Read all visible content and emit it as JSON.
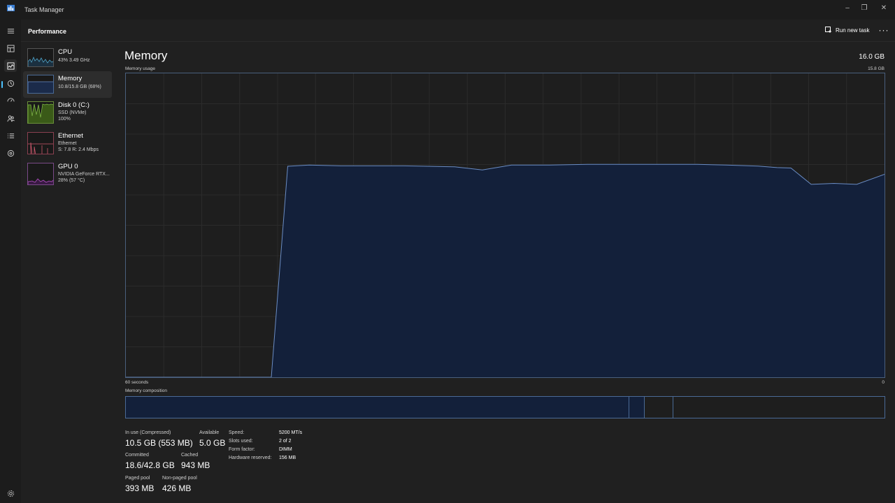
{
  "window": {
    "title": "Task Manager",
    "controls": {
      "minimize": "–",
      "restore": "❐",
      "close": "✕"
    }
  },
  "nav": {
    "items": [
      {
        "name": "hamburger-icon"
      },
      {
        "name": "processes-icon"
      },
      {
        "name": "performance-icon",
        "active": true
      },
      {
        "name": "app-history-icon"
      },
      {
        "name": "startup-apps-icon"
      },
      {
        "name": "users-icon"
      },
      {
        "name": "details-icon"
      },
      {
        "name": "services-icon"
      }
    ],
    "settings": {
      "name": "gear-icon"
    }
  },
  "header": {
    "title": "Performance",
    "run_new_task": "Run new task",
    "more": "···"
  },
  "sidebar": {
    "items": [
      {
        "name": "CPU",
        "sub1": "43%  3.49 GHz",
        "sub2": "",
        "color": "#4fa3c7"
      },
      {
        "name": "Memory",
        "sub1": "10.8/15.8 GB (68%)",
        "sub2": "",
        "color": "#4a6fa5",
        "selected": true
      },
      {
        "name": "Disk 0 (C:)",
        "sub1": "SSD (NVMe)",
        "sub2": "100%",
        "color": "#7db446"
      },
      {
        "name": "Ethernet",
        "sub1": "Ethernet",
        "sub2": "S: 7.8  R: 2.4 Mbps",
        "color": "#d05a6e"
      },
      {
        "name": "GPU 0",
        "sub1": "NVIDIA GeForce RTX...",
        "sub2": "28%  (57 °C)",
        "color": "#b04fc0"
      }
    ]
  },
  "main": {
    "title": "Memory",
    "total": "16.0 GB",
    "usage_label": "Memory usage",
    "usage_max": "15.8 GB",
    "time_label": "60 seconds",
    "time_end": "0",
    "composition_label": "Memory composition",
    "stats": {
      "in_use_label": "In use (Compressed)",
      "in_use_value": "10.5 GB (553 MB)",
      "available_label": "Available",
      "available_value": "5.0 GB",
      "committed_label": "Committed",
      "committed_value": "18.6/42.8 GB",
      "cached_label": "Cached",
      "cached_value": "943 MB",
      "paged_label": "Paged pool",
      "paged_value": "393 MB",
      "nonpaged_label": "Non-paged pool",
      "nonpaged_value": "426 MB"
    },
    "specs": [
      {
        "label": "Speed:",
        "value": "5200 MT/s"
      },
      {
        "label": "Slots used:",
        "value": "2 of 2"
      },
      {
        "label": "Form factor:",
        "value": "DIMM"
      },
      {
        "label": "Hardware reserved:",
        "value": "156 MB"
      }
    ]
  },
  "colors": {
    "accent": "#4cc2ff",
    "memory_fill": "#13203a",
    "memory_line": "#6a8cc4",
    "memory_border": "#4a6a96"
  },
  "chart_data": {
    "type": "area",
    "title": "Memory usage",
    "xlabel": "60 seconds",
    "ylabel": "",
    "xlim": [
      60,
      0
    ],
    "ylim": [
      0,
      15.8
    ],
    "grid": true,
    "series": [
      {
        "values": [
          [
            60,
            0
          ],
          [
            48.5,
            0
          ],
          [
            47.2,
            10.97
          ],
          [
            45.5,
            11.03
          ],
          [
            43,
            10.99
          ],
          [
            38,
            10.99
          ],
          [
            34,
            10.94
          ],
          [
            31.8,
            10.78
          ],
          [
            29.5,
            11.03
          ],
          [
            26.5,
            11.03
          ],
          [
            23.5,
            11.07
          ],
          [
            20,
            11.07
          ],
          [
            17.5,
            11.07
          ],
          [
            14.8,
            11.07
          ],
          [
            12.5,
            11.03
          ],
          [
            10,
            10.98
          ],
          [
            8.5,
            10.9
          ],
          [
            7.4,
            10.88
          ],
          [
            5.8,
            10.03
          ],
          [
            4,
            10.08
          ],
          [
            2.2,
            10.03
          ],
          [
            0,
            10.55
          ]
        ]
      }
    ],
    "composition": [
      {
        "segment": "In use",
        "fraction": 0.663
      },
      {
        "segment": "Modified",
        "fraction": 0.02
      },
      {
        "segment": "Standby",
        "fraction": 0.038
      },
      {
        "segment": "Free",
        "fraction": 0.279
      }
    ]
  }
}
